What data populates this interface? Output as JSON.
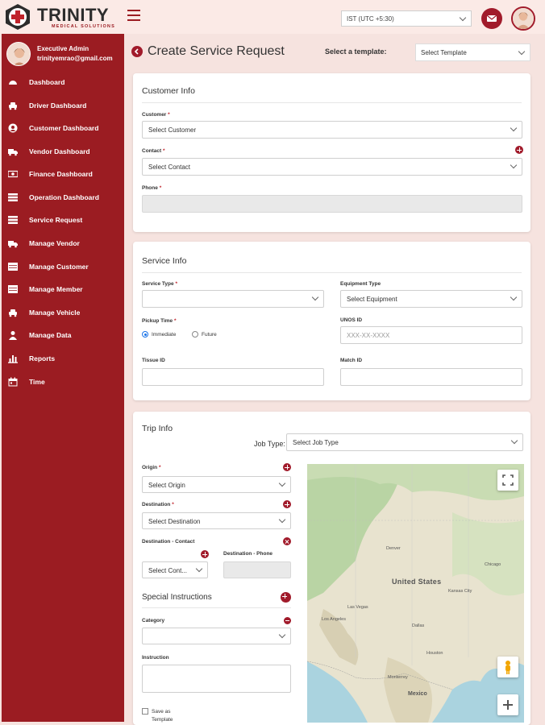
{
  "header": {
    "logo_text": "TRINITY",
    "logo_subtitle": "MEDICAL SOLUTIONS",
    "timezone": "IST (UTC +5:30)"
  },
  "sidebar": {
    "profile_name": "Executive Admin",
    "profile_email": "trinityemrao@gmail.com",
    "items": [
      {
        "label": "Dashboard",
        "icon": "dashboard-icon"
      },
      {
        "label": "Driver Dashboard",
        "icon": "car-icon"
      },
      {
        "label": "Customer Dashboard",
        "icon": "user-circle-icon"
      },
      {
        "label": "Vendor Dashboard",
        "icon": "truck-icon"
      },
      {
        "label": "Finance Dashboard",
        "icon": "money-icon"
      },
      {
        "label": "Operation Dashboard",
        "icon": "list-icon"
      },
      {
        "label": "Service Request",
        "icon": "list-icon"
      },
      {
        "label": "Manage Vendor",
        "icon": "truck-icon"
      },
      {
        "label": "Manage Customer",
        "icon": "table-icon"
      },
      {
        "label": "Manage Member",
        "icon": "table-icon"
      },
      {
        "label": "Manage Vehicle",
        "icon": "car-icon"
      },
      {
        "label": "Manage Data",
        "icon": "user-icon"
      },
      {
        "label": "Reports",
        "icon": "bar-chart-icon"
      },
      {
        "label": "Time",
        "icon": "calendar-icon"
      }
    ]
  },
  "page": {
    "title": "Create Service Request",
    "template_label": "Select a template:",
    "template_value": "Select Template"
  },
  "customer_info": {
    "title": "Customer Info",
    "customer_label": "Customer",
    "customer_value": "Select Customer",
    "contact_label": "Contact",
    "contact_value": "Select Contact",
    "phone_label": "Phone",
    "phone_value": ""
  },
  "service_info": {
    "title": "Service Info",
    "service_type_label": "Service Type",
    "service_type_value": "",
    "equipment_type_label": "Equipment Type",
    "equipment_type_value": "Select Equipment",
    "pickup_time_label": "Pickup Time",
    "pickup_immediate": "Immediate",
    "pickup_future": "Future",
    "unos_label": "UNOS ID",
    "unos_placeholder": "XXX-XX-XXXX",
    "tissue_label": "Tissue ID",
    "match_label": "Match ID"
  },
  "trip_info": {
    "title": "Trip Info",
    "job_type_label": "Job Type:",
    "job_type_value": "Select Job Type",
    "origin_label": "Origin",
    "origin_value": "Select Origin",
    "destination_label": "Destination",
    "destination_value": "Select Destination",
    "dest_contact_label": "Destination - Contact",
    "dest_contact_value": "Select Cont...",
    "dest_phone_label": "Destination - Phone",
    "special_instructions_title": "Special Instructions",
    "category_label": "Category",
    "instruction_label": "Instruction",
    "save_template_label": "Save as Template"
  },
  "map": {
    "country_label": "United States",
    "cities": [
      "Denver",
      "Las Vegas",
      "Los Angeles",
      "Dallas",
      "Houston",
      "Monterrey",
      "Mexico",
      "Kansas City",
      "Chicago"
    ]
  },
  "colors": {
    "brand": "#9b1c22",
    "accent": "#a11b2b",
    "background": "#f6e3df"
  }
}
